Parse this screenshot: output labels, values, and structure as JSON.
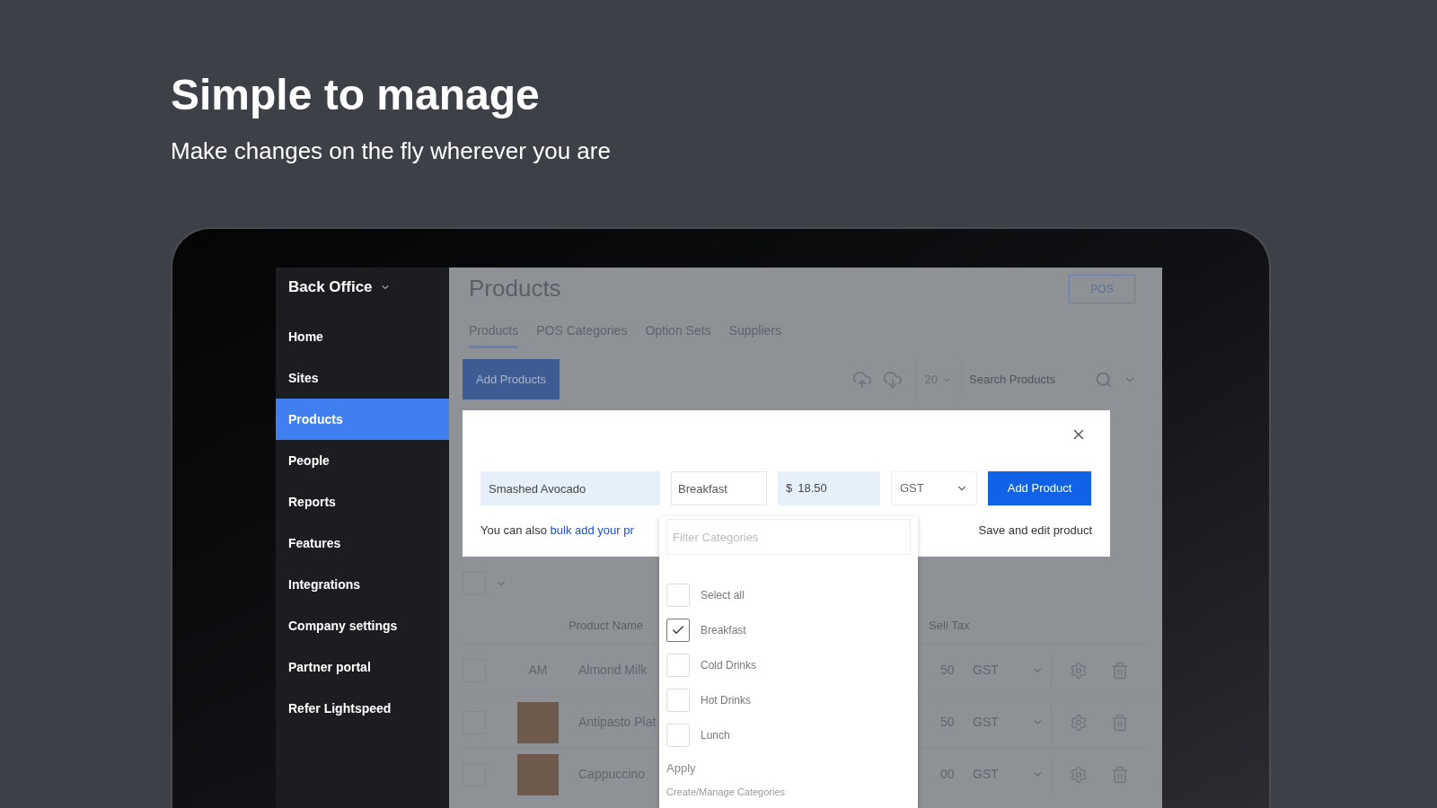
{
  "hero": {
    "title": "Simple to manage",
    "subtitle": "Make changes on the fly wherever you are"
  },
  "sidebar": {
    "title": "Back Office",
    "items": [
      {
        "label": "Home",
        "selected": false
      },
      {
        "label": "Sites",
        "selected": false
      },
      {
        "label": "Products",
        "selected": true
      },
      {
        "label": "People",
        "selected": false
      },
      {
        "label": "Reports",
        "selected": false
      },
      {
        "label": "Features",
        "selected": false
      },
      {
        "label": "Integrations",
        "selected": false
      },
      {
        "label": "Company settings",
        "selected": false
      },
      {
        "label": "Partner portal",
        "selected": false
      },
      {
        "label": "Refer Lightspeed",
        "selected": false
      }
    ]
  },
  "page": {
    "title": "Products",
    "pos_button": "POS",
    "tabs": [
      {
        "label": "Products",
        "selected": true
      },
      {
        "label": "POS Categories",
        "selected": false
      },
      {
        "label": "Option Sets",
        "selected": false
      },
      {
        "label": "Suppliers",
        "selected": false
      }
    ],
    "add_button": "Add Products",
    "per_page": "20",
    "search": {
      "placeholder": "Search Products"
    }
  },
  "table": {
    "select_all": {
      "checked": false
    },
    "columns": [
      "Product Name",
      "Sell Tax"
    ],
    "rows": [
      {
        "kind": "initials",
        "initials": "AM",
        "name": "Almond Milk",
        "price": "50",
        "tax": "GST",
        "checked": false
      },
      {
        "kind": "photo",
        "name": "Antipasto Plat",
        "price": "50",
        "tax": "GST",
        "checked": false
      },
      {
        "kind": "photo",
        "name": "Cappuccino",
        "price": "00",
        "tax": "GST",
        "checked": false
      }
    ]
  },
  "modal": {
    "name": "Smashed Avocado",
    "category": "Breakfast",
    "currency": "$",
    "price": "18.50",
    "tax": "GST",
    "add_button": "Add Product",
    "note": "You can also",
    "note_link": "bulk add your pr",
    "save_link": "Save and edit product"
  },
  "category_dropdown": {
    "filter": {
      "placeholder": "Filter Categories"
    },
    "options": [
      {
        "label": "Select all",
        "checked": false
      },
      {
        "label": "Breakfast",
        "checked": true
      },
      {
        "label": "Cold Drinks",
        "checked": false
      },
      {
        "label": "Hot Drinks",
        "checked": false
      },
      {
        "label": "Lunch",
        "checked": false
      }
    ],
    "apply": "Apply",
    "manage": "Create/Manage Categories"
  }
}
